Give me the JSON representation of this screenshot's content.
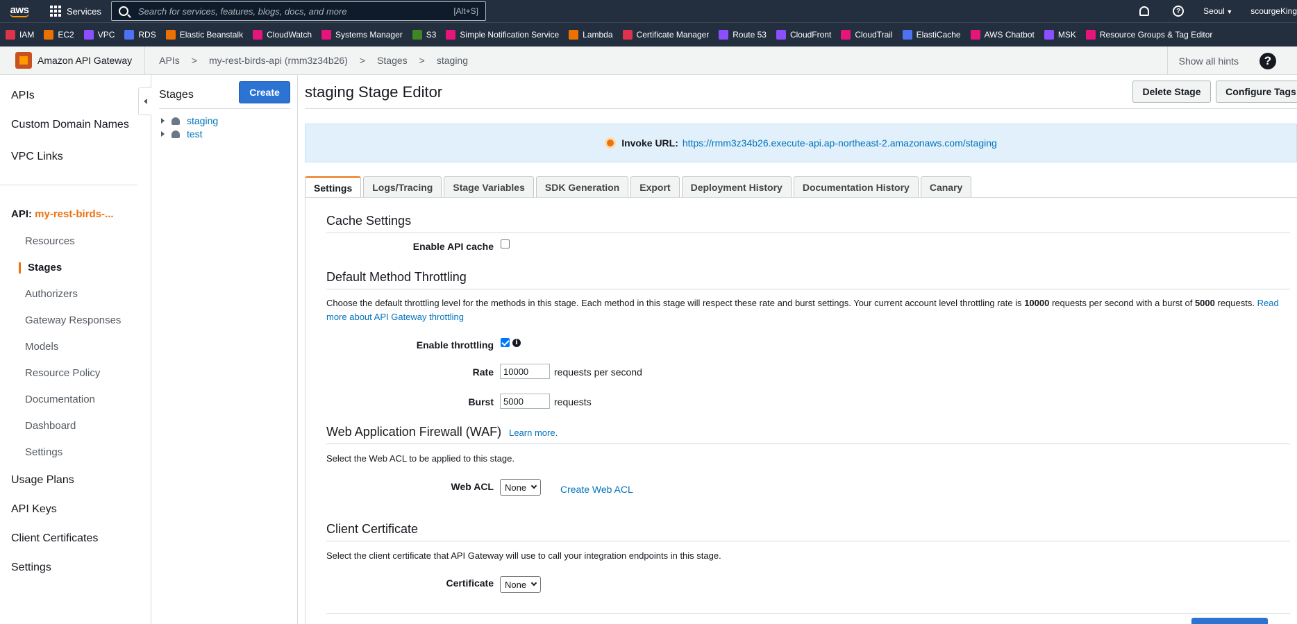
{
  "topnav": {
    "services": "Services",
    "search_placeholder": "Search for services, features, blogs, docs, and more",
    "search_shortcut": "[Alt+S]",
    "region": "Seoul",
    "user": "scourgeKing"
  },
  "favorites": [
    {
      "label": "IAM",
      "color": "#dd344c"
    },
    {
      "label": "EC2",
      "color": "#ed7100"
    },
    {
      "label": "VPC",
      "color": "#8c4fff"
    },
    {
      "label": "RDS",
      "color": "#4d72f3"
    },
    {
      "label": "Elastic Beanstalk",
      "color": "#ed7100"
    },
    {
      "label": "CloudWatch",
      "color": "#e7157b"
    },
    {
      "label": "Systems Manager",
      "color": "#e7157b"
    },
    {
      "label": "S3",
      "color": "#3f8624"
    },
    {
      "label": "Simple Notification Service",
      "color": "#e7157b"
    },
    {
      "label": "Lambda",
      "color": "#ed7100"
    },
    {
      "label": "Certificate Manager",
      "color": "#dd344c"
    },
    {
      "label": "Route 53",
      "color": "#8c4fff"
    },
    {
      "label": "CloudFront",
      "color": "#8c4fff"
    },
    {
      "label": "CloudTrail",
      "color": "#e7157b"
    },
    {
      "label": "ElastiCache",
      "color": "#4d72f3"
    },
    {
      "label": "AWS Chatbot",
      "color": "#e7157b"
    },
    {
      "label": "MSK",
      "color": "#8c4fff"
    },
    {
      "label": "Resource Groups & Tag Editor",
      "color": "#e7157b"
    }
  ],
  "breadcrumb": {
    "service": "Amazon API Gateway",
    "items": [
      "APIs",
      "my-rest-birds-api (rmm3z34b26)",
      "Stages",
      "staging"
    ],
    "separator": ">",
    "hints": "Show all hints"
  },
  "leftnav": {
    "top_items": [
      "APIs",
      "Custom Domain Names",
      "VPC Links"
    ],
    "api_prefix": "API:",
    "api_name": "my-rest-birds-...",
    "sub_items": [
      "Resources",
      "Stages",
      "Authorizers",
      "Gateway Responses",
      "Models",
      "Resource Policy",
      "Documentation",
      "Dashboard",
      "Settings"
    ],
    "bottom_items": [
      "Usage Plans",
      "API Keys",
      "Client Certificates",
      "Settings"
    ]
  },
  "stages_panel": {
    "title": "Stages",
    "create": "Create",
    "items": [
      "staging",
      "test"
    ]
  },
  "main": {
    "heading": "staging Stage Editor",
    "delete_stage": "Delete Stage",
    "configure_tags": "Configure Tags",
    "invoke_label": "Invoke URL:",
    "invoke_url": "https://rmm3z34b26.execute-api.ap-northeast-2.amazonaws.com/staging",
    "tabs": [
      "Settings",
      "Logs/Tracing",
      "Stage Variables",
      "SDK Generation",
      "Export",
      "Deployment History",
      "Documentation History",
      "Canary"
    ],
    "cache": {
      "title": "Cache Settings",
      "enable_label": "Enable API cache",
      "enabled": false
    },
    "throttling": {
      "title": "Default Method Throttling",
      "desc_1": "Choose the default throttling level for the methods in this stage. Each method in this stage will respect these rate and burst settings. Your current account level throttling rate is",
      "rate_bold": "10000",
      "desc_2": "requests per second with a burst of",
      "burst_bold": "5000",
      "desc_3": "requests.",
      "read_more": "Read more about API Gateway throttling",
      "enable_label": "Enable throttling",
      "enabled": true,
      "rate_label": "Rate",
      "rate_value": "10000",
      "rate_unit": "requests per second",
      "burst_label": "Burst",
      "burst_value": "5000",
      "burst_unit": "requests"
    },
    "waf": {
      "title": "Web Application Firewall (WAF)",
      "learn_more": "Learn more.",
      "desc": "Select the Web ACL to be applied to this stage.",
      "acl_label": "Web ACL",
      "acl_value": "None",
      "create_acl": "Create Web ACL"
    },
    "client_cert": {
      "title": "Client Certificate",
      "desc": "Select the client certificate that API Gateway will use to call your integration endpoints in this stage.",
      "cert_label": "Certificate",
      "cert_value": "None"
    }
  }
}
